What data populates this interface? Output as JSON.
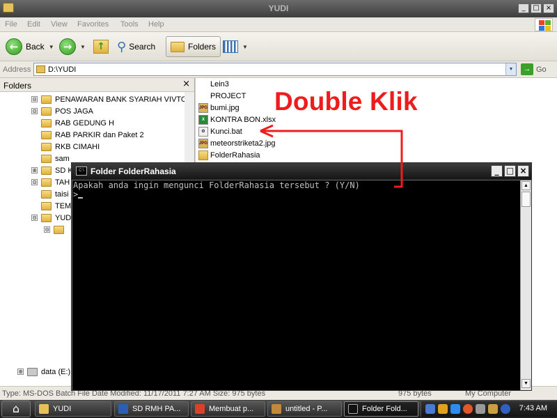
{
  "window": {
    "title": "YUDI",
    "controls": [
      "_",
      "□",
      "×"
    ]
  },
  "menu": [
    "File",
    "Edit",
    "View",
    "Favorites",
    "Tools",
    "Help"
  ],
  "toolbar": {
    "back": "Back",
    "search": "Search",
    "folders": "Folders"
  },
  "address": {
    "label": "Address",
    "value": "D:\\YUDI",
    "go": "Go"
  },
  "folders_pane": {
    "title": "Folders",
    "close": "×",
    "items": [
      {
        "label": "PENAWARAN BANK SYARIAH VIVTORIA",
        "expander": "⊟"
      },
      {
        "label": "POS JAGA",
        "expander": "⊟"
      },
      {
        "label": "RAB GEDUNG H",
        "expander": ""
      },
      {
        "label": "RAB PARKIR dan Paket 2",
        "expander": ""
      },
      {
        "label": "RKB CIMAHI",
        "expander": ""
      },
      {
        "label": "sam",
        "expander": ""
      },
      {
        "label": "SD K",
        "expander": "⊞"
      },
      {
        "label": "TAH",
        "expander": "⊟"
      },
      {
        "label": "taisi",
        "expander": ""
      },
      {
        "label": "TEM",
        "expander": ""
      },
      {
        "label": "YUD",
        "expander": "⊟"
      },
      {
        "label": "",
        "expander": "⊟"
      },
      {
        "label": "data (E:)",
        "expander": "⊞"
      }
    ]
  },
  "files": [
    {
      "name": "Lein3",
      "type": "none"
    },
    {
      "name": "PROJECT",
      "type": "none"
    },
    {
      "name": "bumi.jpg",
      "type": "jpg"
    },
    {
      "name": "KONTRA BON.xlsx",
      "type": "xls"
    },
    {
      "name": "Kunci.bat",
      "type": "bat"
    },
    {
      "name": "meteorstriketa2.jpg",
      "type": "jpg"
    },
    {
      "name": "FolderRahasia",
      "type": "folder"
    }
  ],
  "annotation": {
    "text": "Double Klik",
    "color": "#ee1c1c"
  },
  "console": {
    "title": "Folder FolderRahasia",
    "line1": "Apakah anda ingin mengunci FolderRahasia tersebut ? (Y/N)",
    "prompt": ">",
    "controls": [
      "_",
      "□",
      "×"
    ]
  },
  "statusbar": {
    "left": "Type: MS-DOS Batch File Date Modified: 11/17/2011 7:27 AM Size: 975 bytes",
    "size": "975 bytes",
    "zone": "My Computer"
  },
  "taskbar": {
    "tasks": [
      {
        "label": "YUDI",
        "icon_color": "#e6c15a"
      },
      {
        "label": "SD RMH PA...",
        "icon_color": "#2b5fb4"
      },
      {
        "label": "Membuat p...",
        "icon_color": "#d9412b"
      },
      {
        "label": "untitled - P...",
        "icon_color": "#c08a3a"
      },
      {
        "label": "Folder Fold...",
        "icon_color": "#111111"
      }
    ],
    "clock": "7:43 AM"
  }
}
